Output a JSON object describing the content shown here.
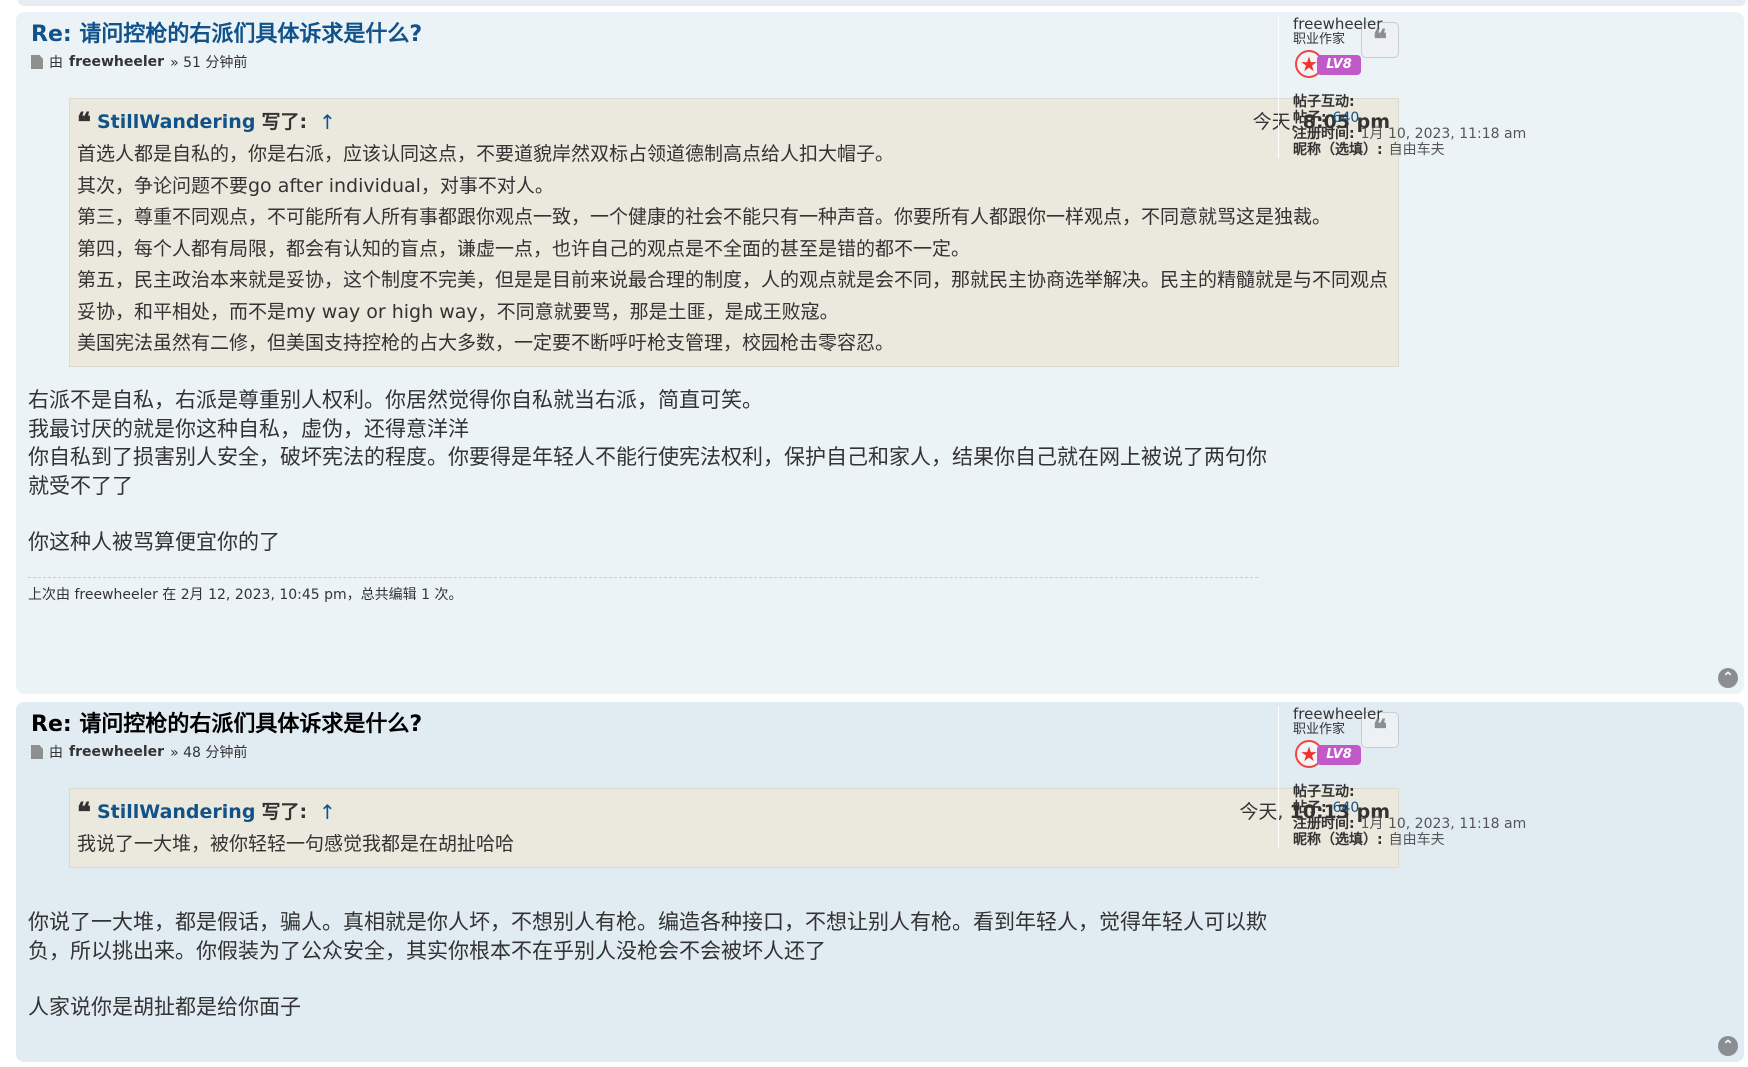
{
  "posts": [
    {
      "title": "Re: 请问控枪的右派们具体诉求是什么?",
      "author_prefix": "由",
      "author": "freewheeler",
      "time_ago": "» 51 分钟前",
      "quote": {
        "user": "StillWandering",
        "wrote": "写了:",
        "arrow": "↑",
        "time_prefix": "今天, ",
        "time": "8:05 pm",
        "lines": [
          "首选人都是自私的，你是右派，应该认同这点，不要道貌岸然双标占领道德制高点给人扣大帽子。",
          "其次，争论问题不要go after individual，对事不对人。",
          "第三，尊重不同观点，不可能所有人所有事都跟你观点一致，一个健康的社会不能只有一种声音。你要所有人都跟你一样观点，不同意就骂这是独裁。",
          "第四，每个人都有局限，都会有认知的盲点，谦虚一点，也许自己的观点是不全面的甚至是错的都不一定。",
          "第五，民主政治本来就是妥协，这个制度不完美，但是是目前来说最合理的制度，人的观点就是会不同，那就民主协商选举解决。民主的精髓就是与不同观点妥协，和平相处，而不是my way or high way，不同意就要骂，那是土匪，是成王败寇。",
          "美国宪法虽然有二修，但美国支持控枪的占大多数，一定要不断呼吁枪支管理，校园枪击零容忍。"
        ]
      },
      "body": [
        "右派不是自私，右派是尊重别人权利。你居然觉得你自私就当右派，简直可笑。",
        "我最讨厌的就是你这种自私，虚伪，还得意洋洋",
        "你自私到了损害别人安全，破坏宪法的程度。你要得是年轻人不能行使宪法权利，保护自己和家人，结果你自己就在网上被说了两句你就受不了了",
        "",
        "你这种人被骂算便宜你的了"
      ],
      "edit_note": "上次由 freewheeler 在 2月 12, 2023, 10:45 pm，总共编辑 1 次。",
      "profile": {
        "name": "freewheeler",
        "rank": "职业作家",
        "level": "LV8",
        "interact_label": "帖子互动:",
        "posts_label": "帖子:",
        "posts_value": "640",
        "joined_label": "注册时间:",
        "joined_value": "1月 10, 2023, 11:18 am",
        "nick_label": "昵称（选填）:",
        "nick_value": "自由车夫"
      }
    },
    {
      "title": "Re: 请问控枪的右派们具体诉求是什么?",
      "author_prefix": "由",
      "author": "freewheeler",
      "time_ago": "» 48 分钟前",
      "quote": {
        "user": "StillWandering",
        "wrote": "写了:",
        "arrow": "↑",
        "time_prefix": "今天, ",
        "time": "10:13 pm",
        "lines": [
          "我说了一大堆，被你轻轻一句感觉我都是在胡扯哈哈"
        ]
      },
      "body": [
        "你说了一大堆，都是假话，骗人。真相就是你人坏，不想别人有枪。编造各种接口，不想让别人有枪。看到年轻人，觉得年轻人可以欺负，所以挑出来。你假装为了公众安全，其实你根本不在乎别人没枪会不会被坏人还了",
        "",
        "人家说你是胡扯都是给你面子"
      ],
      "profile": {
        "name": "freewheeler",
        "rank": "职业作家",
        "level": "LV8",
        "interact_label": "帖子互动:",
        "posts_label": "帖子:",
        "posts_value": "640",
        "joined_label": "注册时间:",
        "joined_value": "1月 10, 2023, 11:18 am",
        "nick_label": "昵称（选填）:",
        "nick_value": "自由车夫"
      }
    }
  ],
  "icons": {
    "quote": "quote-icon",
    "top": "chevron-up-icon",
    "doc": "document-icon"
  }
}
